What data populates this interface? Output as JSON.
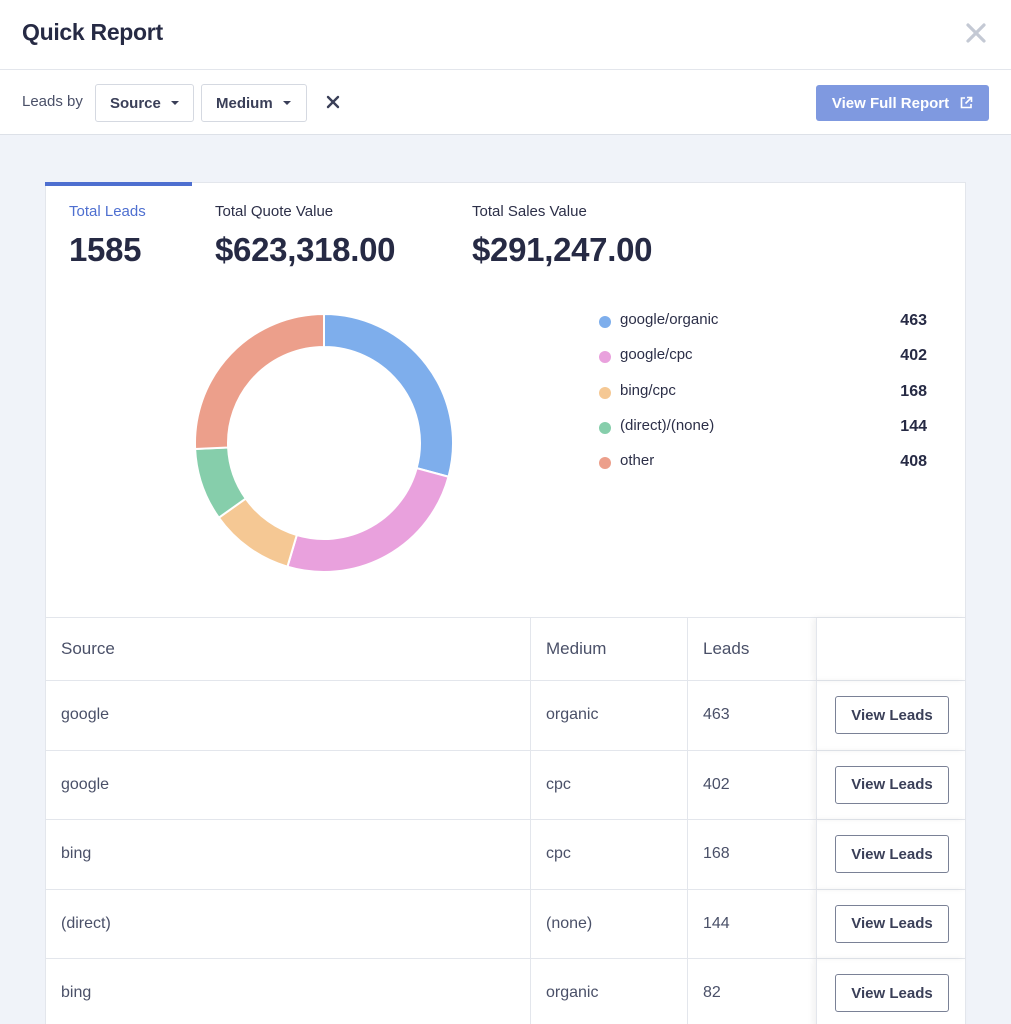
{
  "header": {
    "title": "Quick Report",
    "close_icon": "close-icon"
  },
  "toolbar": {
    "leads_by_label": "Leads by",
    "source_dropdown": "Source",
    "medium_dropdown": "Medium",
    "full_report_button": "View Full Report"
  },
  "stats": [
    {
      "label": "Total Leads",
      "value": "1585",
      "active": true
    },
    {
      "label": "Total Quote Value",
      "value": "$623,318.00"
    },
    {
      "label": "Total Sales Value",
      "value": "$291,247.00"
    }
  ],
  "colors": {
    "accent": "#4e6fd0",
    "button": "#7f99e0",
    "google_organic": "#7eaeec",
    "google_cpc": "#e9a1dd",
    "bing_cpc": "#f5c894",
    "direct_none": "#86ceab",
    "other": "#ec9f8b"
  },
  "chart_data": {
    "type": "pie",
    "donut": true,
    "categories": [
      "google/organic",
      "google/cpc",
      "bing/cpc",
      "(direct)/(none)",
      "other"
    ],
    "values": [
      463,
      402,
      168,
      144,
      408
    ],
    "colors": [
      "#7eaeec",
      "#e9a1dd",
      "#f5c894",
      "#86ceab",
      "#ec9f8b"
    ],
    "legend_position": "right"
  },
  "table": {
    "columns": [
      "Source",
      "Medium",
      "Leads",
      ""
    ],
    "rows": [
      {
        "source": "google",
        "medium": "organic",
        "leads": "463",
        "action": "View Leads"
      },
      {
        "source": "google",
        "medium": "cpc",
        "leads": "402",
        "action": "View Leads"
      },
      {
        "source": "bing",
        "medium": "cpc",
        "leads": "168",
        "action": "View Leads"
      },
      {
        "source": "(direct)",
        "medium": "(none)",
        "leads": "144",
        "action": "View Leads"
      },
      {
        "source": "bing",
        "medium": "organic",
        "leads": "82",
        "action": "View Leads"
      }
    ]
  }
}
